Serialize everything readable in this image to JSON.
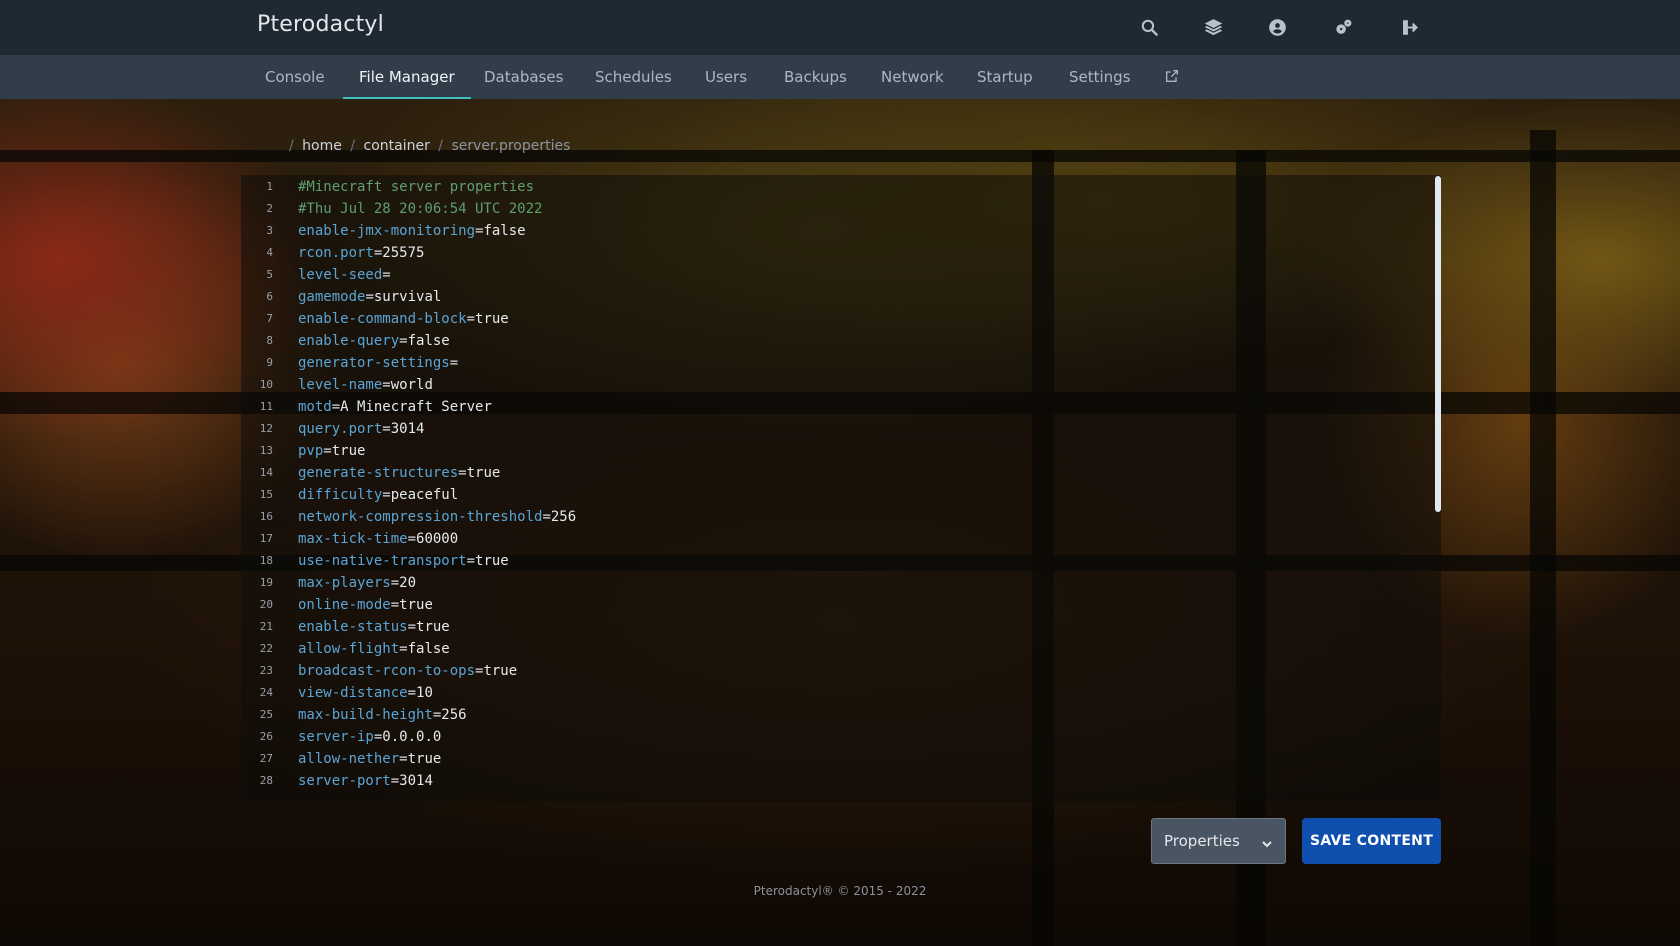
{
  "app": {
    "brand": "Pterodactyl"
  },
  "topbar": {
    "icons": [
      "search-icon",
      "layers-icon",
      "account-icon",
      "settings-icon",
      "logout-icon"
    ]
  },
  "tabs": [
    {
      "label": "Console",
      "active": false
    },
    {
      "label": "File Manager",
      "active": true
    },
    {
      "label": "Databases",
      "active": false
    },
    {
      "label": "Schedules",
      "active": false
    },
    {
      "label": "Users",
      "active": false
    },
    {
      "label": "Backups",
      "active": false
    },
    {
      "label": "Network",
      "active": false
    },
    {
      "label": "Startup",
      "active": false
    },
    {
      "label": "Settings",
      "active": false
    }
  ],
  "breadcrumb": {
    "root_sep": "/",
    "parts": [
      "home",
      "container"
    ],
    "sep": "/",
    "current": "server.properties"
  },
  "editor": {
    "lines": [
      {
        "n": "1",
        "comment": "#Minecraft server properties"
      },
      {
        "n": "2",
        "comment": "#Thu Jul 28 20:06:54 UTC 2022"
      },
      {
        "n": "3",
        "key": "enable-jmx-monitoring",
        "val": "false"
      },
      {
        "n": "4",
        "key": "rcon.port",
        "val": "25575"
      },
      {
        "n": "5",
        "key": "level-seed",
        "val": ""
      },
      {
        "n": "6",
        "key": "gamemode",
        "val": "survival"
      },
      {
        "n": "7",
        "key": "enable-command-block",
        "val": "true"
      },
      {
        "n": "8",
        "key": "enable-query",
        "val": "false"
      },
      {
        "n": "9",
        "key": "generator-settings",
        "val": ""
      },
      {
        "n": "10",
        "key": "level-name",
        "val": "world"
      },
      {
        "n": "11",
        "key": "motd",
        "val": "A Minecraft Server"
      },
      {
        "n": "12",
        "key": "query.port",
        "val": "3014"
      },
      {
        "n": "13",
        "key": "pvp",
        "val": "true"
      },
      {
        "n": "14",
        "key": "generate-structures",
        "val": "true"
      },
      {
        "n": "15",
        "key": "difficulty",
        "val": "peaceful"
      },
      {
        "n": "16",
        "key": "network-compression-threshold",
        "val": "256"
      },
      {
        "n": "17",
        "key": "max-tick-time",
        "val": "60000"
      },
      {
        "n": "18",
        "key": "use-native-transport",
        "val": "true"
      },
      {
        "n": "19",
        "key": "max-players",
        "val": "20"
      },
      {
        "n": "20",
        "key": "online-mode",
        "val": "true"
      },
      {
        "n": "21",
        "key": "enable-status",
        "val": "true"
      },
      {
        "n": "22",
        "key": "allow-flight",
        "val": "false"
      },
      {
        "n": "23",
        "key": "broadcast-rcon-to-ops",
        "val": "true"
      },
      {
        "n": "24",
        "key": "view-distance",
        "val": "10"
      },
      {
        "n": "25",
        "key": "max-build-height",
        "val": "256"
      },
      {
        "n": "26",
        "key": "server-ip",
        "val": "0.0.0.0"
      },
      {
        "n": "27",
        "key": "allow-nether",
        "val": "true"
      },
      {
        "n": "28",
        "key": "server-port",
        "val": "3014"
      }
    ]
  },
  "controls": {
    "mode_select_value": "Properties",
    "save_label": "SAVE CONTENT"
  },
  "footer": {
    "text": "Pterodactyl® © 2015 - 2022"
  },
  "colors": {
    "topbar": "#1f2933",
    "subnav": "#323d4a",
    "tab_active_underline": "#3fbfbf",
    "save_button": "#0f4fad",
    "code_key": "#5aa5d6",
    "code_comment": "#5f9e6e"
  }
}
